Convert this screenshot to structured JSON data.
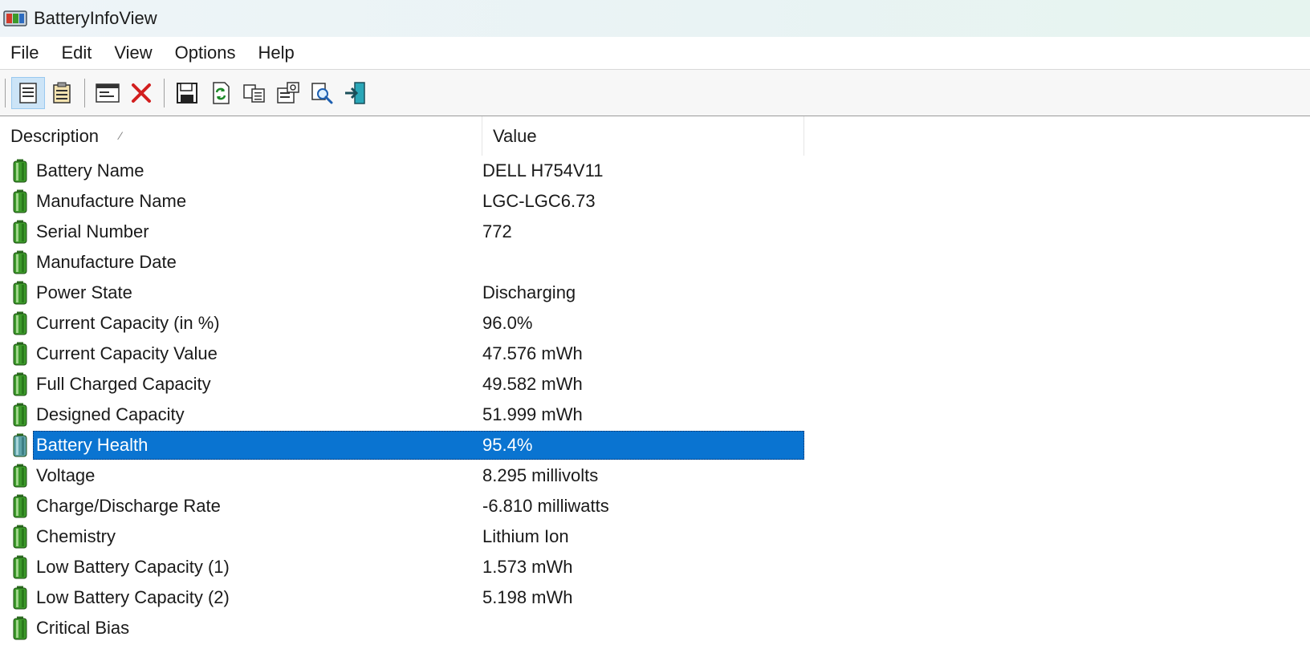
{
  "window": {
    "title": "BatteryInfoView",
    "app_icon": "battery-app-icon"
  },
  "menu": [
    "File",
    "Edit",
    "View",
    "Options",
    "Help"
  ],
  "toolbar": {
    "buttons": [
      {
        "name": "general-info-mode-icon",
        "active": true
      },
      {
        "name": "battery-log-mode-icon",
        "active": false
      },
      {
        "name": "properties-window-icon",
        "active": false
      },
      {
        "name": "delete-x-icon",
        "active": false
      },
      {
        "name": "save-floppy-icon",
        "active": false
      },
      {
        "name": "refresh-icon",
        "active": false
      },
      {
        "name": "copy-icon",
        "active": false
      },
      {
        "name": "properties-icon",
        "active": false
      },
      {
        "name": "find-icon",
        "active": false
      },
      {
        "name": "exit-icon",
        "active": false
      }
    ]
  },
  "list": {
    "columns": [
      "Description",
      "Value"
    ],
    "sort_indicator": "⁄",
    "selected_index": 9,
    "rows": [
      {
        "description": "Battery Name",
        "value": "DELL H754V11"
      },
      {
        "description": "Manufacture Name",
        "value": "LGC-LGC6.73"
      },
      {
        "description": "Serial Number",
        "value": "772"
      },
      {
        "description": "Manufacture Date",
        "value": ""
      },
      {
        "description": "Power State",
        "value": "Discharging"
      },
      {
        "description": "Current Capacity (in %)",
        "value": "96.0%"
      },
      {
        "description": "Current Capacity Value",
        "value": "47.576 mWh"
      },
      {
        "description": "Full Charged Capacity",
        "value": "49.582 mWh"
      },
      {
        "description": "Designed Capacity",
        "value": "51.999 mWh"
      },
      {
        "description": "Battery Health",
        "value": "95.4%"
      },
      {
        "description": "Voltage",
        "value": "8.295 millivolts"
      },
      {
        "description": "Charge/Discharge Rate",
        "value": "-6.810 milliwatts"
      },
      {
        "description": "Chemistry",
        "value": "Lithium Ion"
      },
      {
        "description": "Low Battery Capacity (1)",
        "value": "1.573 mWh"
      },
      {
        "description": "Low Battery Capacity (2)",
        "value": "5.198 mWh"
      },
      {
        "description": "Critical Bias",
        "value": ""
      }
    ]
  },
  "colors": {
    "selection": "#0a74d1",
    "battery_green": "#3c9a2a"
  }
}
